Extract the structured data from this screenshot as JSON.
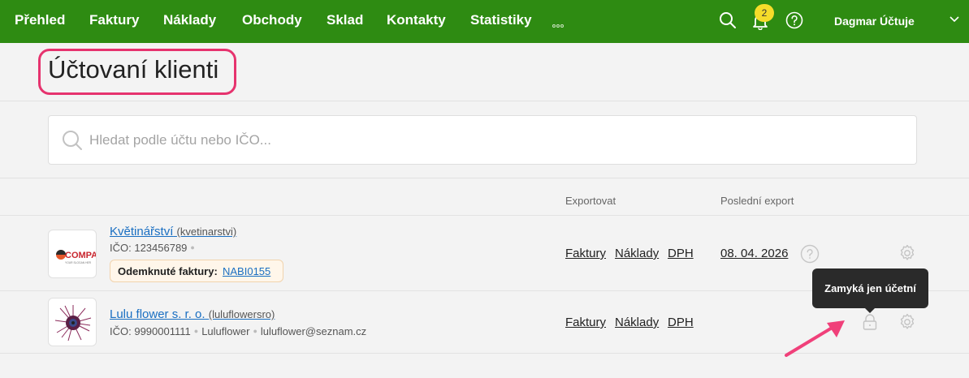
{
  "nav": {
    "items": [
      "Přehled",
      "Faktury",
      "Náklady",
      "Obchody",
      "Sklad",
      "Kontakty",
      "Statistiky"
    ],
    "more_icon": "more-dots-icon",
    "search_icon": "search-icon",
    "bell_icon": "bell-icon",
    "notification_count": "2",
    "help_icon": "help-icon",
    "user_name": "Dagmar Účtuje",
    "user_chevron_icon": "chevron-down-icon",
    "background_color": "#2e8b12",
    "badge_color": "#f5dc2a"
  },
  "page": {
    "title": "Účtovaní klienti",
    "title_highlight_color": "#e6336e"
  },
  "search": {
    "placeholder": "Hledat podle účtu nebo IČO...",
    "value": ""
  },
  "table": {
    "headers": {
      "export": "Exportovat",
      "last_export": "Poslední export"
    },
    "rows": [
      {
        "name": "Květinářství",
        "slug": "(kvetinarstvi)",
        "ico": "IČO: 123456789",
        "logo_text": "COMPA",
        "logo_subtext": "YOUR SLOGAN HER",
        "unlocked_label": "Odemknuté faktury:",
        "unlocked_value": "NABI0155",
        "export_links": [
          "Faktury",
          "Náklady",
          "DPH"
        ],
        "last_export": "08. 04. 2026"
      },
      {
        "name": "Lulu flower s. r. o.",
        "slug": "(luluflowersro)",
        "ico": "IČO: 9990001111",
        "company_short": "Luluflower",
        "email": "luluflower@seznam.cz",
        "export_links": [
          "Faktury",
          "Náklady",
          "DPH"
        ],
        "lock_tooltip": "Zamyká jen účetní"
      }
    ]
  },
  "annotation": {
    "arrow_color": "#f0407a"
  }
}
